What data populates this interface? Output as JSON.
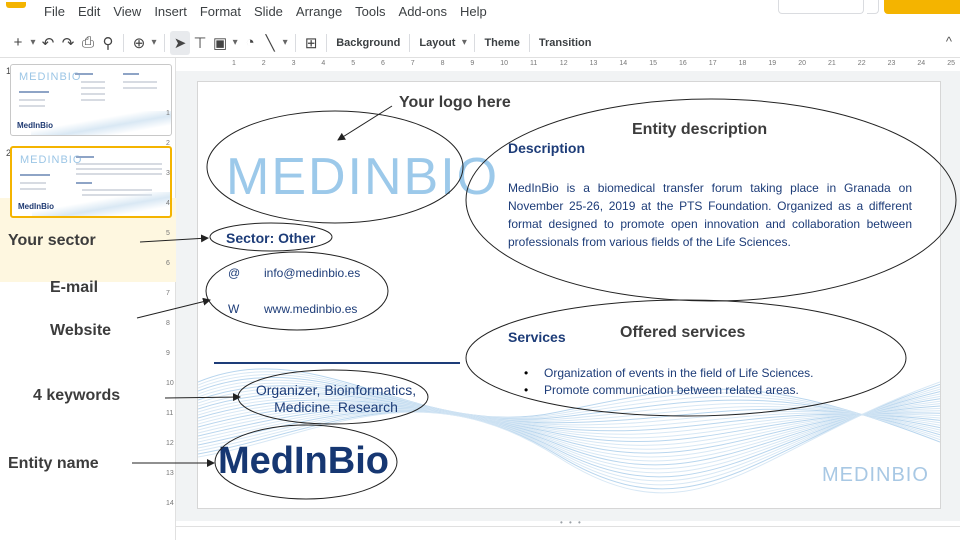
{
  "menu": [
    "File",
    "Edit",
    "View",
    "Insert",
    "Format",
    "Slide",
    "Arrange",
    "Tools",
    "Add-ons",
    "Help"
  ],
  "toolbar": {
    "background_label": "Background",
    "layout_label": "Layout",
    "theme_label": "Theme",
    "transition_label": "Transition"
  },
  "filmstrip": {
    "slides": [
      {
        "number": "1",
        "logo": "MEDINBIO",
        "name": "MedInBio"
      },
      {
        "number": "2",
        "logo": "MEDINBIO",
        "name": "MedInBio"
      }
    ]
  },
  "ruler": {
    "horizontal": [
      "1",
      "2",
      "3",
      "4",
      "5",
      "6",
      "7",
      "8",
      "9",
      "10",
      "11",
      "12",
      "13",
      "14",
      "15",
      "16",
      "17",
      "18",
      "19",
      "20",
      "21",
      "22",
      "23",
      "24",
      "25"
    ],
    "vertical": [
      "1",
      "2",
      "3",
      "4",
      "5",
      "6",
      "7",
      "8",
      "9",
      "10",
      "11",
      "12",
      "13",
      "14"
    ]
  },
  "slide": {
    "logo_text": "MEDINBIO",
    "sector": "Sector: Other",
    "email_label": "@",
    "email": "info@medinbio.es",
    "web_label": "W",
    "website": "www.medinbio.es",
    "keywords_line1": "Organizer, Bioinformatics,",
    "keywords_line2": "Medicine, Research",
    "entity_name": "MedInBio",
    "small_logo": "MEDINBIO",
    "description_title": "Description",
    "description_body": "MedInBio is a biomedical transfer forum taking place in Granada on November 25-26, 2019 at the PTS Foundation. Organized as a different format designed to promote open innovation and collaboration between professionals from various fields of the Life Sciences.",
    "services_title": "Services",
    "services": [
      "Organization of events in the field of Life Sciences.",
      "Promote communication between related areas."
    ]
  },
  "annotations": {
    "logo": "Your logo here",
    "entity_description": "Entity description",
    "sector": "Your sector",
    "email": "E-mail",
    "website": "Website",
    "offered_services": "Offered services",
    "keywords": "4 keywords",
    "entity_name": "Entity name"
  },
  "colors": {
    "accent": "#f4b400",
    "brand_dark": "#1d3c78",
    "brand_light": "#9cc9ea"
  }
}
